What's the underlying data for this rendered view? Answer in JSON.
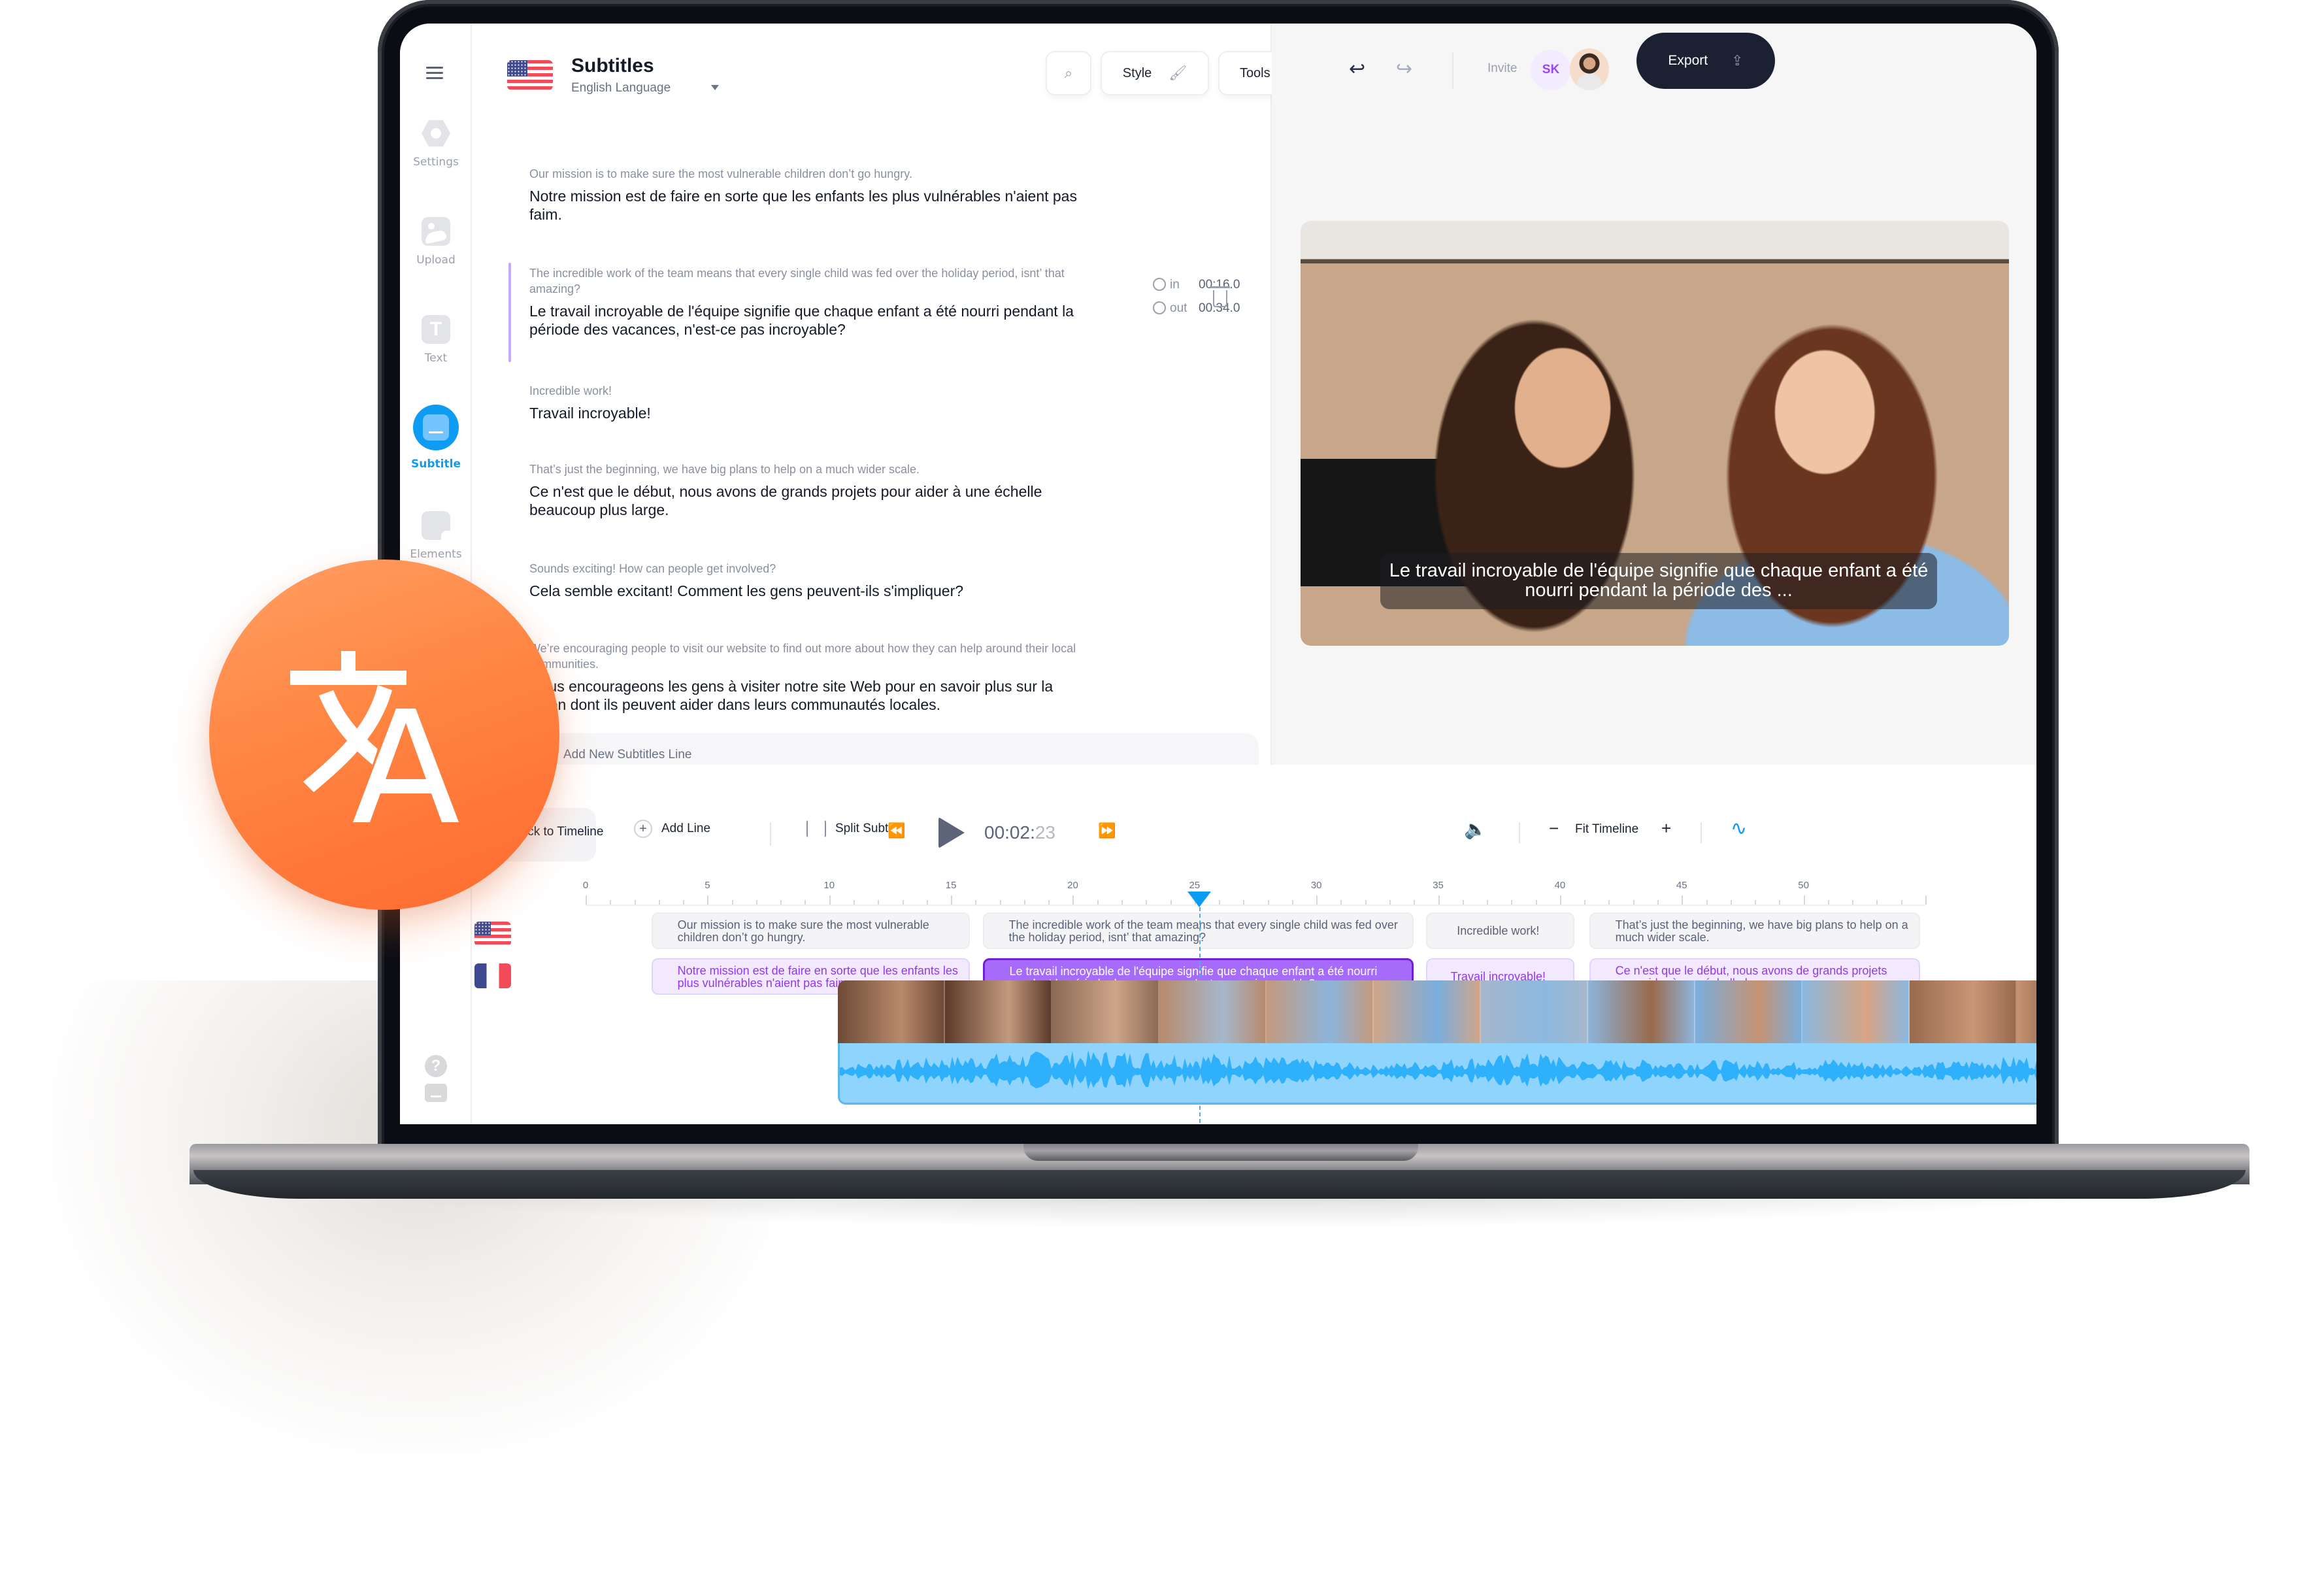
{
  "sidebar": {
    "items": [
      {
        "label": "Settings",
        "icon": "settings-hex-icon"
      },
      {
        "label": "Upload",
        "icon": "image-icon"
      },
      {
        "label": "Text",
        "icon": "text-t-icon"
      },
      {
        "label": "Subtitle",
        "icon": "subtitle-icon",
        "active": true
      },
      {
        "label": "Elements",
        "icon": "sticker-icon"
      }
    ],
    "bottom_icons": [
      "help-icon",
      "keyboard-icon"
    ],
    "help_glyph": "?",
    "text_glyph": "T"
  },
  "panel": {
    "title": "Subtitles",
    "language": "English Language",
    "search_icon": "⌕",
    "style_label": "Style",
    "tools_label": "Tools",
    "entries": [
      {
        "en": "Our mission is to make sure the most vulnerable children don’t go hungry.",
        "fr": "Notre mission est de faire en sorte que les enfants les plus vulnérables n'aient pas faim."
      },
      {
        "en": "The incredible work of the team means that every single child was fed over the holiday period, isnt’ that amazing?",
        "fr": "Le travail incroyable de l'équipe signifie que chaque enfant a été nourri pendant la période des vacances, n'est-ce pas incroyable?",
        "active": true,
        "in_label": "in",
        "in_time": "00:16.0",
        "out_label": "out",
        "out_time": "00:34.0"
      },
      {
        "en": "Incredible work!",
        "fr": "Travail incroyable!"
      },
      {
        "en": "That’s just the beginning, we have big plans to help on a much wider scale.",
        "fr": "Ce n'est que le début, nous avons de grands projets pour aider à une échelle beaucoup plus large."
      },
      {
        "en": "Sounds exciting! How can people get involved?",
        "fr": "Cela semble excitant! Comment les gens peuvent-ils s'impliquer?"
      },
      {
        "en": "We’re encouraging people to visit our website to find out more about how they can help around their local communities.",
        "fr": "Nous encourageons les gens à visiter notre site Web pour en savoir plus sur la façon dont ils peuvent aider dans leurs communautés locales."
      }
    ],
    "add_line_label": "Add New Subtitles Line"
  },
  "header": {
    "undo_glyph": "↩",
    "redo_glyph": "↪",
    "invite_label": "Invite",
    "avatar_initials": "SK",
    "export_label": "Export",
    "export_glyph": "⇪"
  },
  "video": {
    "caption": "Le travail incroyable de l'équipe signifie que chaque enfant a été nourri pendant la période des ..."
  },
  "timeline": {
    "back_label": "Back to Timeline",
    "add_line_label": "Add Line",
    "split_label": "Split Subtitle",
    "rewind_glyph": "⏪",
    "forward_glyph": "⏩",
    "time_main": "00:02:",
    "time_frames": "23",
    "volume_glyph": "🔈",
    "zoom_out_glyph": "−",
    "fit_label": "Fit Timeline",
    "zoom_in_glyph": "+",
    "waveform_glyph": "∿",
    "ruler_ticks": [
      "0",
      "5",
      "10",
      "15",
      "20",
      "25",
      "30",
      "35",
      "40",
      "45",
      "50"
    ],
    "ruler_max_seconds": 55,
    "playhead_seconds": 25.2,
    "tracks": {
      "en": [
        {
          "text": "Our mission is to make sure the most vulnerable children don’t go hungry.",
          "start": 2.7,
          "end": 16.0
        },
        {
          "text": "The incredible work of the team means that every single child was fed over the holiday period, isnt’ that amazing?",
          "start": 16.3,
          "end": 34.2
        },
        {
          "text": "Incredible work!",
          "start": 34.5,
          "end": 40.8
        },
        {
          "text": "That’s just the beginning, we have big plans to help on a much wider scale.",
          "start": 41.2,
          "end": 55.0
        }
      ],
      "fr": [
        {
          "text": "Notre mission est de faire en sorte que les enfants les plus vulnérables n'aient pas faim.",
          "start": 2.7,
          "end": 16.0
        },
        {
          "text": "Le travail incroyable de l'équipe signifie que chaque enfant a été nourri pendant la période des vacances, n'est-ce pas incroyable?",
          "start": 16.3,
          "end": 34.2,
          "selected": true
        },
        {
          "text": "Travail incroyable!",
          "start": 34.5,
          "end": 40.8
        },
        {
          "text": "Ce n'est que le début, nous avons de grands projets pour aider à une échelle beaucoup...",
          "start": 41.2,
          "end": 55.0
        }
      ]
    },
    "waveform_color": "#2fb0fb",
    "waveform_bg": "#8fd4fd"
  },
  "badge": {
    "icon": "translate-icon",
    "color": "#ff7a3a"
  }
}
